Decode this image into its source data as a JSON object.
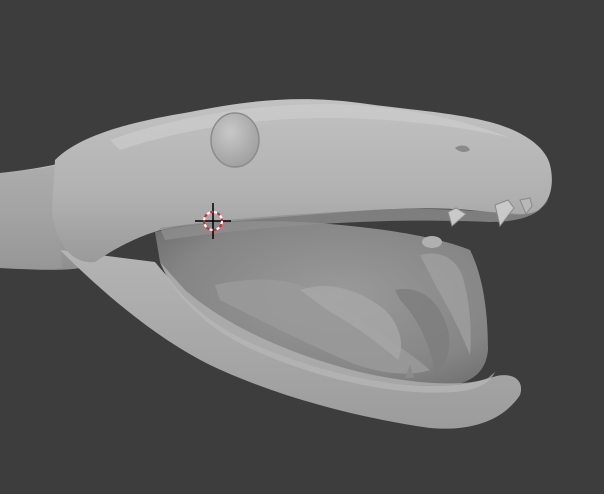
{
  "viewport": {
    "background_color": "#3d3d3d",
    "model": {
      "name": "snake-head-sculpt",
      "material_color": "#a9a9a9",
      "mouth_color": "#8f8f8f"
    },
    "cursor_3d": {
      "icon": "3d-cursor-icon",
      "ring_colors": [
        "#ffffff",
        "#e0242f"
      ]
    }
  }
}
